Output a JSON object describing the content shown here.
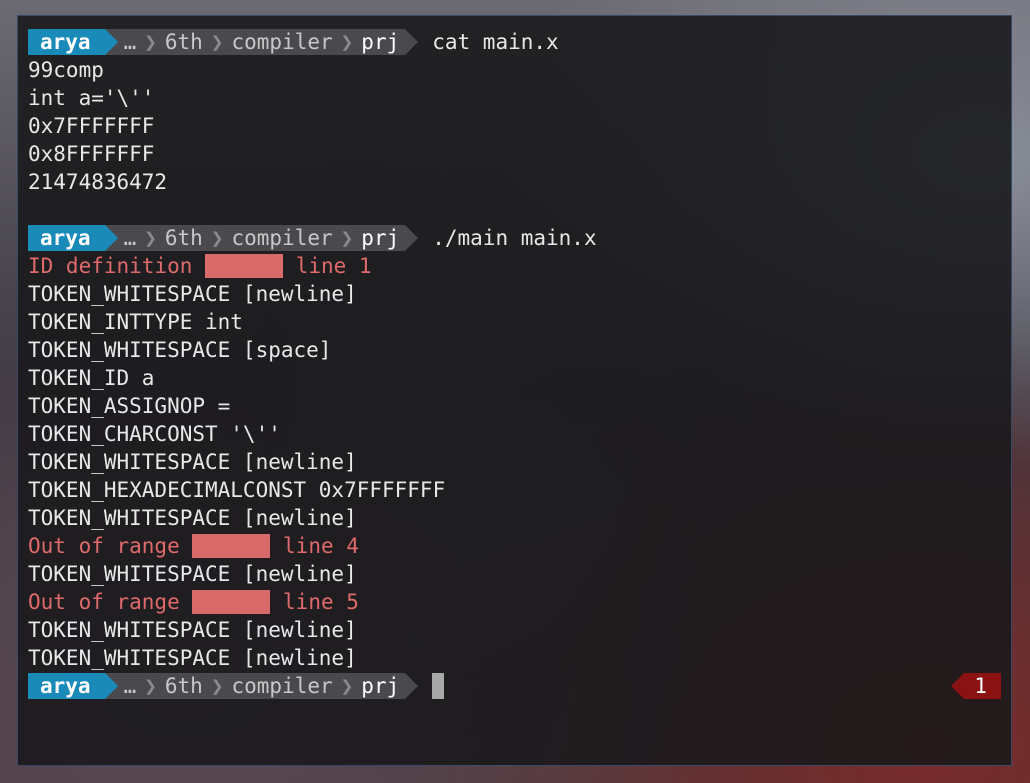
{
  "prompt": {
    "user": "arya",
    "path": [
      "…",
      "6th",
      "compiler",
      "prj"
    ]
  },
  "blocks": [
    {
      "command": "cat main.x",
      "output": [
        {
          "text": "99comp",
          "type": "normal"
        },
        {
          "text": "int a='\\''",
          "type": "normal"
        },
        {
          "text": "0x7FFFFFFF",
          "type": "normal"
        },
        {
          "text": "0x8FFFFFFF",
          "type": "normal"
        },
        {
          "text": "21474836472",
          "type": "normal"
        },
        {
          "text": "",
          "type": "normal"
        }
      ]
    },
    {
      "command": "./main main.x",
      "output": [
        {
          "text": "ID definition",
          "suffix": "line 1",
          "type": "error",
          "redacted": true
        },
        {
          "text": "TOKEN_WHITESPACE [newline]",
          "type": "normal"
        },
        {
          "text": "TOKEN_INTTYPE int",
          "type": "normal"
        },
        {
          "text": "TOKEN_WHITESPACE [space]",
          "type": "normal"
        },
        {
          "text": "TOKEN_ID a",
          "type": "normal"
        },
        {
          "text": "TOKEN_ASSIGNOP =",
          "type": "normal"
        },
        {
          "text": "TOKEN_CHARCONST '\\''",
          "type": "normal"
        },
        {
          "text": "TOKEN_WHITESPACE [newline]",
          "type": "normal"
        },
        {
          "text": "TOKEN_HEXADECIMALCONST 0x7FFFFFFF",
          "type": "normal"
        },
        {
          "text": "TOKEN_WHITESPACE [newline]",
          "type": "normal"
        },
        {
          "text": "Out of range",
          "suffix": "line 4",
          "type": "error",
          "redacted": true
        },
        {
          "text": "TOKEN_WHITESPACE [newline]",
          "type": "normal"
        },
        {
          "text": "Out of range",
          "suffix": "line 5",
          "type": "error",
          "redacted": true
        },
        {
          "text": "TOKEN_WHITESPACE [newline]",
          "type": "normal"
        },
        {
          "text": "TOKEN_WHITESPACE [newline]",
          "type": "normal"
        }
      ]
    }
  ],
  "final_prompt": {
    "exit_status": "1"
  },
  "colors": {
    "user_segment": "#1a8bb8",
    "path_segment": "#4a4a4e",
    "error_text": "#e06a6a",
    "status_error": "#8a1212"
  }
}
